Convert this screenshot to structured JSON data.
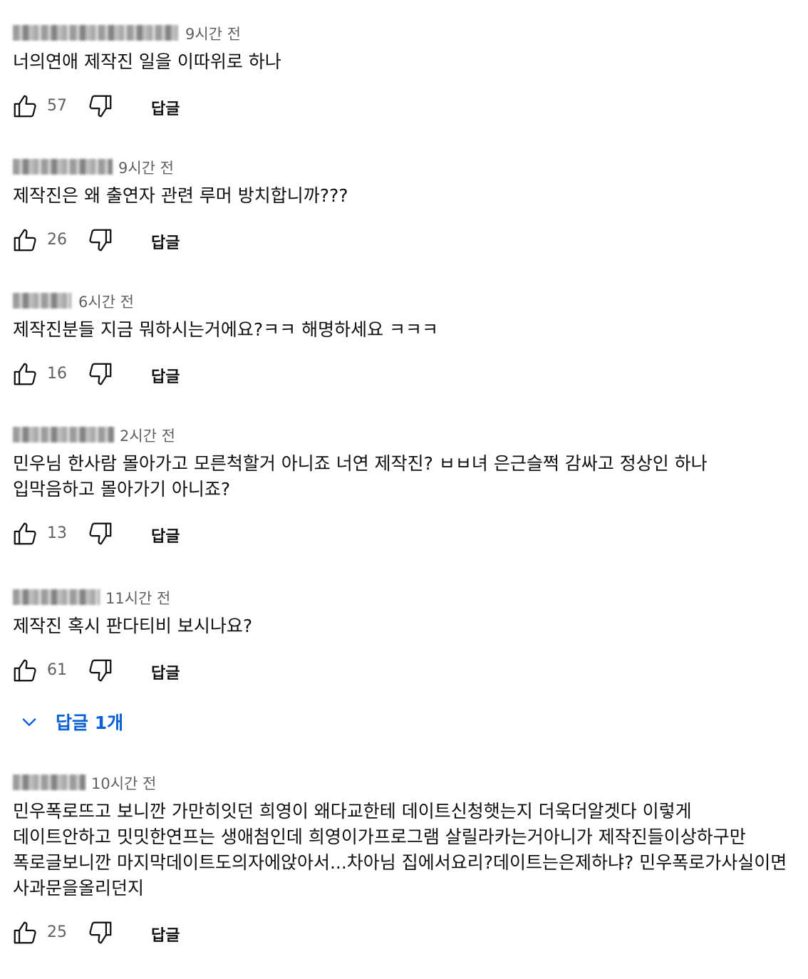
{
  "comments": [
    {
      "time": "9시간 전",
      "text": "너의연애 제작진 일을 이따위로 하나",
      "likes": "57",
      "reply_label": "답글"
    },
    {
      "time": "9시간 전",
      "text": "제작진은 왜 출연자 관련 루머 방치합니까???",
      "likes": "26",
      "reply_label": "답글"
    },
    {
      "time": "6시간 전",
      "text": "제작진분들 지금 뭐하시는거에요?ㅋㅋ 해명하세요 ㅋㅋㅋ",
      "likes": "16",
      "reply_label": "답글"
    },
    {
      "time": "2시간 전",
      "text": "민우님 한사람 몰아가고 모른척할거 아니죠 너연 제작진? ㅂㅂ녀 은근슬쩍 감싸고 정상인 하나 입막음하고 몰아가기 아니죠?",
      "likes": "13",
      "reply_label": "답글"
    },
    {
      "time": "11시간 전",
      "text": "제작진 혹시 판다티비 보시나요?",
      "likes": "61",
      "reply_label": "답글",
      "replies_toggle": "답글 1개"
    },
    {
      "time": "10시간 전",
      "text": "민우폭로뜨고 보니깐 가만히잇던 희영이 왜다교한테 데이트신청햇는지 더욱더알겟다 이렇게 데이트안하고 밋밋한연프는 생애첨인데 희영이가프로그램 살릴라카는거아니가 제작진들이상하구만 폭로글보니깐 마지막데이트도의자에앉아서...차아님 집에서요리?데이트는은제하냐? 민우폭로가사실이면 사과문을올리던지",
      "likes": "25",
      "reply_label": "답글"
    }
  ],
  "colors": {
    "text": "#0f0f0f",
    "meta": "#606060",
    "link": "#065fd4"
  }
}
